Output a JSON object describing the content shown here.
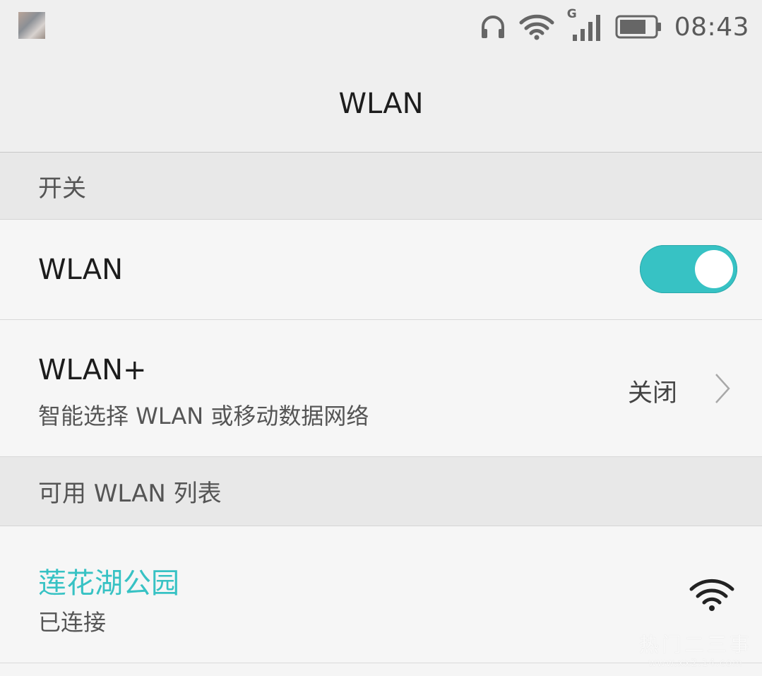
{
  "status_bar": {
    "time": "08:43",
    "network_type": "G",
    "icons": [
      "notification-thumbnail",
      "headphones-icon",
      "wifi-icon",
      "signal-icon",
      "battery-icon"
    ]
  },
  "header": {
    "title": "WLAN"
  },
  "sections": {
    "switch_header": "开关",
    "available_header": "可用 WLAN 列表"
  },
  "wlan_row": {
    "label": "WLAN",
    "toggle_on": true
  },
  "wlan_plus_row": {
    "label": "WLAN+",
    "subtitle": "智能选择 WLAN 或移动数据网络",
    "value": "关闭"
  },
  "networks": [
    {
      "ssid": "莲花湖公园",
      "status": "已连接",
      "signal_icon": "wifi-full-icon"
    }
  ],
  "watermark": {
    "main": "热门二三事",
    "url": "www.xx2.14.com"
  },
  "colors": {
    "accent": "#37c2c4",
    "connected_ssid": "#37c2c4"
  }
}
